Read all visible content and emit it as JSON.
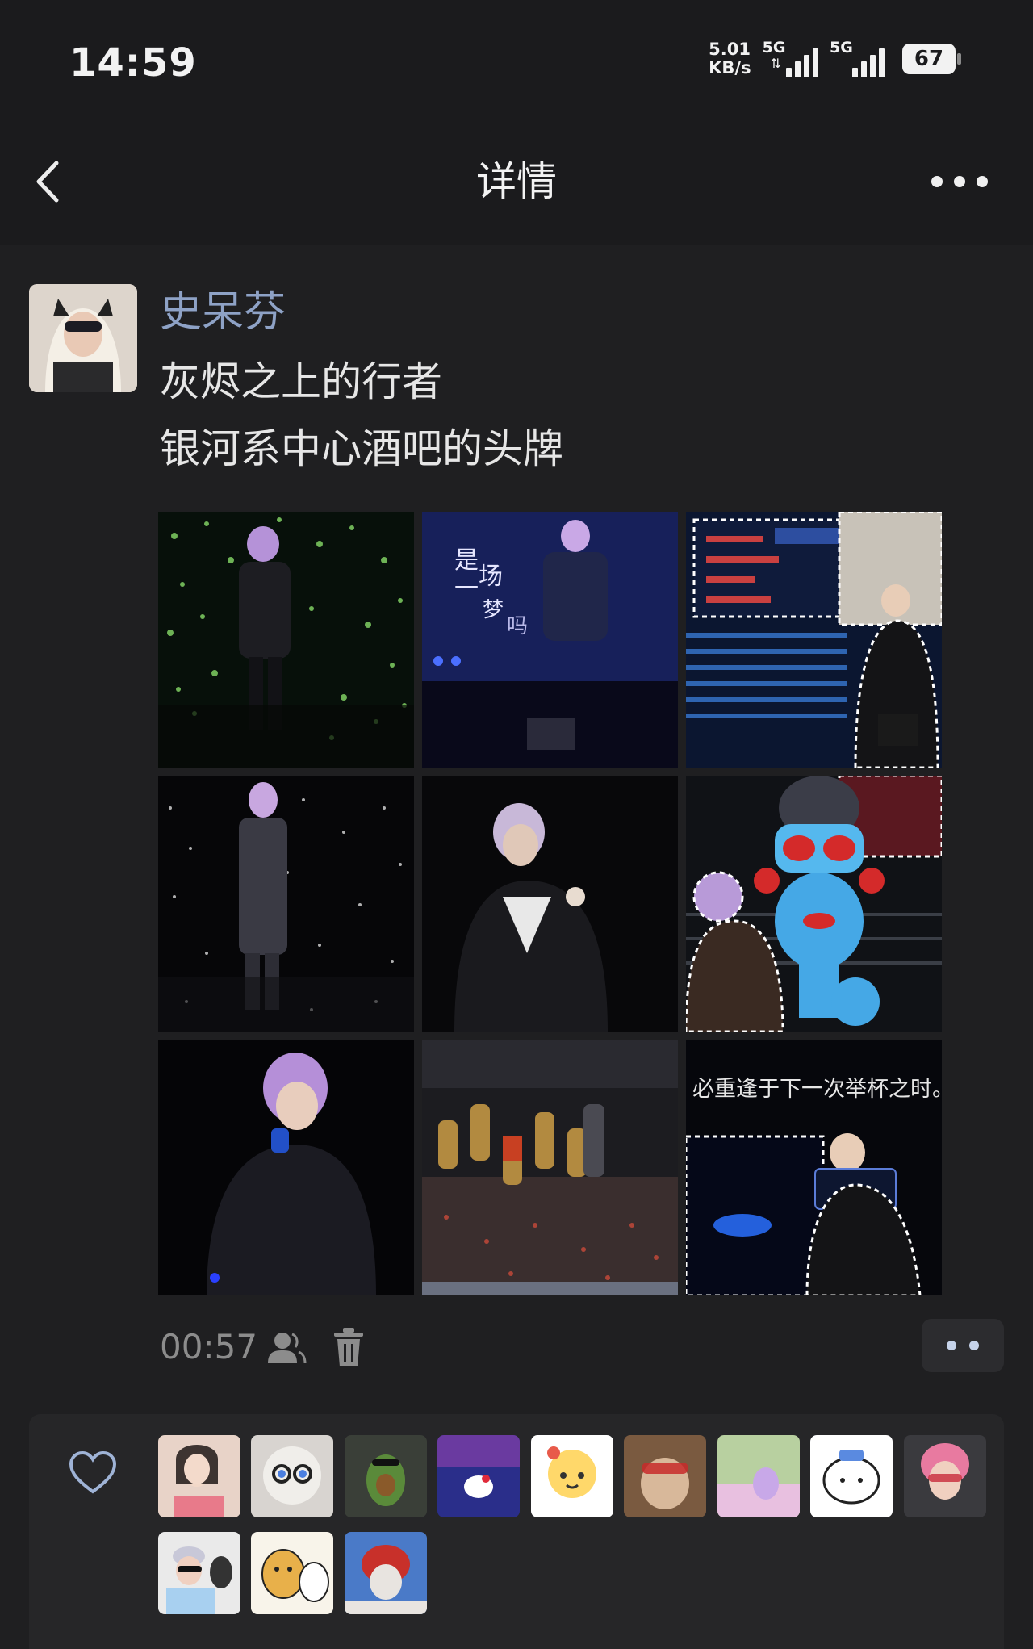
{
  "status_bar": {
    "time": "14:59",
    "net_speed_value": "5.01",
    "net_speed_unit": "KB/s",
    "network_1": "5G",
    "network_2": "5G",
    "battery": "67"
  },
  "header": {
    "title": "详情"
  },
  "post": {
    "author": "史呆芬",
    "text_line_1": "灰烬之上的行者",
    "text_line_2": "银河系中心酒吧的头牌",
    "images": [
      {
        "index": 1,
        "overlay_text": ""
      },
      {
        "index": 2,
        "overlay_text": "是一场梦吗"
      },
      {
        "index": 3,
        "overlay_text": ""
      },
      {
        "index": 4,
        "overlay_text": ""
      },
      {
        "index": 5,
        "overlay_text": ""
      },
      {
        "index": 6,
        "overlay_text": ""
      },
      {
        "index": 7,
        "overlay_text": ""
      },
      {
        "index": 8,
        "overlay_text": ""
      },
      {
        "index": 9,
        "overlay_text": "必重逢于下一次举杯之时。"
      }
    ],
    "time": "00:57"
  },
  "likes": {
    "count_shown": 12
  },
  "colors": {
    "background": "#1b1b1d",
    "username": "#8ea2c6",
    "meta_gray": "#8c8c8c",
    "accent": "#c6d3ea"
  }
}
